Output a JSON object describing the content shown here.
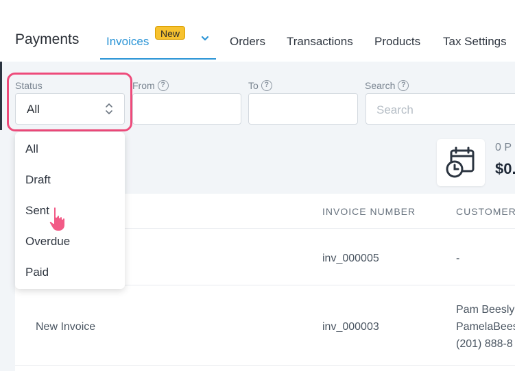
{
  "header": {
    "title": "Payments",
    "tabs": [
      {
        "label": "Invoices",
        "active": true,
        "badge": "New"
      },
      {
        "label": "Orders"
      },
      {
        "label": "Transactions"
      },
      {
        "label": "Products"
      },
      {
        "label": "Tax Settings"
      }
    ]
  },
  "filters": {
    "status": {
      "label": "Status",
      "value": "All",
      "options": [
        "All",
        "Draft",
        "Sent",
        "Overdue",
        "Paid"
      ]
    },
    "from": {
      "label": "From"
    },
    "to": {
      "label": "To"
    },
    "search": {
      "label": "Search",
      "placeholder": "Search"
    }
  },
  "summary": {
    "count_text": "0 P",
    "amount_text": "$0."
  },
  "table": {
    "columns": [
      "INVOICE NUMBER",
      "CUSTOMER"
    ],
    "rows": [
      {
        "name": "",
        "invoice_number": "inv_000005",
        "customer": "-"
      },
      {
        "name": "New Invoice",
        "invoice_number": "inv_000003",
        "customer_lines": [
          "Pam Beesly",
          "PamelaBees",
          "(201) 888-8"
        ]
      }
    ]
  },
  "colors": {
    "accent": "#2a94d6",
    "highlight": "#ee4a7a",
    "badge": "#f7c22f"
  },
  "icons": [
    "help-circle-icon",
    "chevron-updown-icon",
    "calendar-clock-icon",
    "pointer-hand-icon",
    "chevron-down-icon"
  ]
}
